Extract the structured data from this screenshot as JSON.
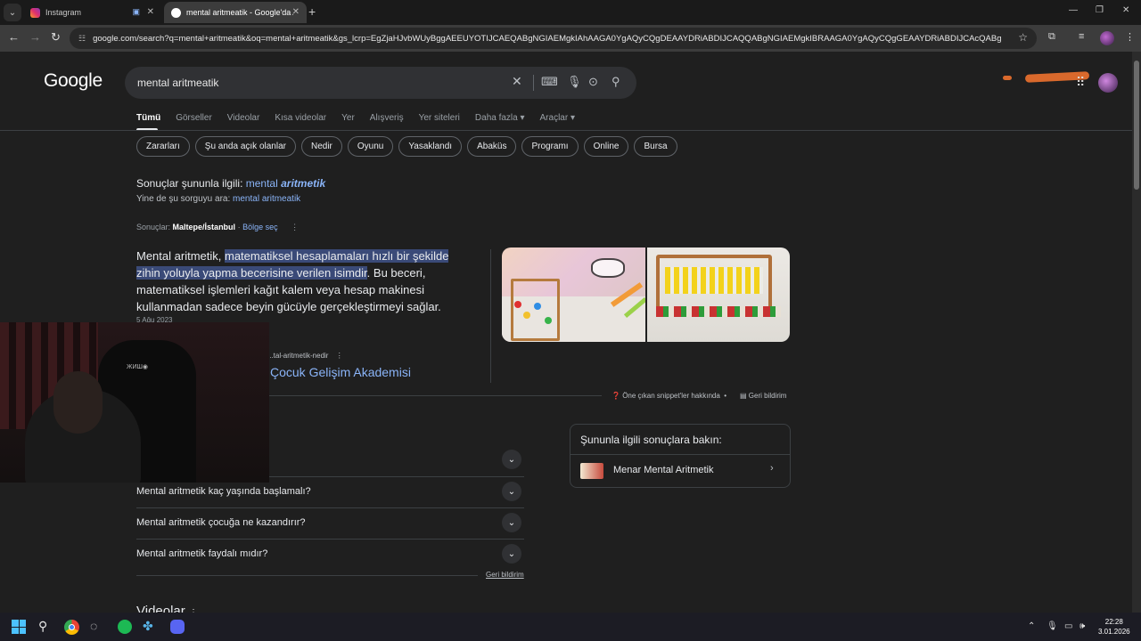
{
  "browser": {
    "tabs": [
      {
        "title": "Instagram"
      },
      {
        "title": "mental aritmeatik - Google'da A"
      }
    ],
    "url": "google.com/search?q=mental+aritmeatik&oq=mental+aritmeatik&gs_lcrp=EgZjaHJvbWUyBggAEEUYOTIJCAEQABgNGIAEMgkIAhAAGA0YgAQyCQgDEAAYDRiABDIJCAQQABgNGIAEMgkIBRAAGA0YgAQyCQgGEAAYDRiABDIJCAcQABgNGIAEMgkICB..."
  },
  "google": {
    "logo": "Google",
    "query": "mental aritmeatik",
    "tabs": [
      "Tümü",
      "Görseller",
      "Videolar",
      "Kısa videolar",
      "Yer",
      "Alışveriş",
      "Yer siteleri",
      "Daha fazla ▾",
      "Araçlar ▾"
    ],
    "chips": [
      "Zararları",
      "Şu anda açık olanlar",
      "Nedir",
      "Oyunu",
      "Yasaklandı",
      "Abaküs",
      "Programı",
      "Online",
      "Bursa"
    ],
    "correction": {
      "prefix": "Sonuçlar şununla ilgili:",
      "link_plain": "mental",
      "link_bold": "aritmetik",
      "instead_prefix": "Yine de şu sorguyu ara:",
      "instead_link": "mental aritmeatik"
    },
    "location": {
      "prefix": "Sonuçlar:",
      "place": "Maltepe/İstanbul",
      "sep": " · ",
      "link": "Bölge seç"
    },
    "snippet": {
      "lead": "Mental aritmetik, ",
      "highlight": "matematiksel hesaplamaları hızlı bir şekilde zihin yoluyla yapma becerisine verilen isimdir",
      "rest": ". Bu beceri, matematiksel işlemleri kağıt kalem veya hesap makinesi kullanmadan sadece beyin gücüyle gerçekleştirmeyi sağlar.",
      "date": "5 Ağu 2023",
      "source_url": "...tal-aritmetik-nedir",
      "source_title": "Çocuk Gelişim Akademisi",
      "about": "Öne çıkan snippet'ler hakkında",
      "feedback": "Geri bildirim"
    },
    "paa": [
      "Mental aritmetik kaç yaşında başlamalı?",
      "Mental aritmetik çocuğa ne kazandırır?",
      "Mental aritmetik faydalı mıdır?"
    ],
    "paa_feedback": "Geri bildirim",
    "related": {
      "heading": "Şununla ilgili sonuçlara bakın:",
      "item": "Menar Mental Aritmetik"
    },
    "videos_heading": "Videolar"
  },
  "taskbar": {
    "time": "22:28",
    "date": "3.01.2026"
  },
  "icons": [
    "search-icon",
    "close-icon",
    "keyboard-icon",
    "mic-icon",
    "lens-icon",
    "apps-icon",
    "chevron-down-icon",
    "star-icon",
    "back-icon",
    "forward-icon",
    "reload-icon"
  ]
}
